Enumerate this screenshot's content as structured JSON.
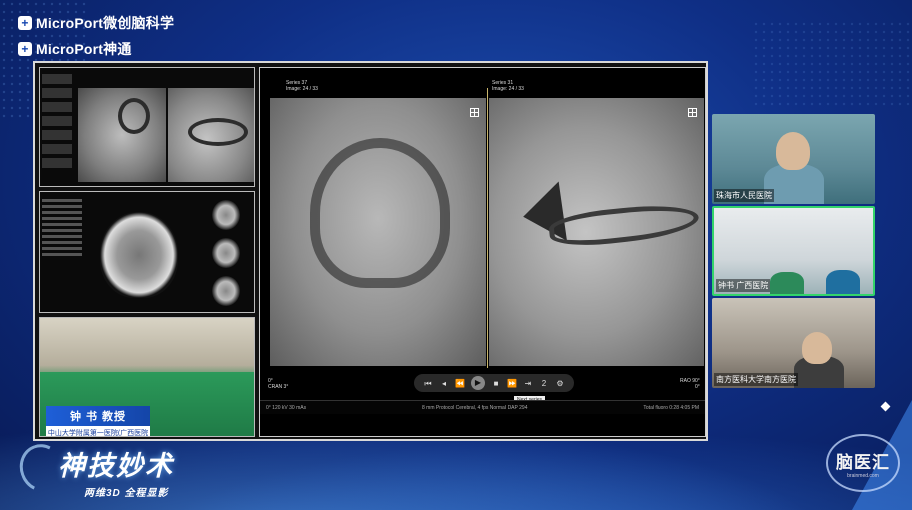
{
  "brand": {
    "line1_mark": "+",
    "line1": "MicroPort微创脑科学",
    "line2_mark": "+",
    "line2": "MicroPort神通"
  },
  "main_viewer": {
    "left_series": "Series 37",
    "left_image": "Image: 24 / 33",
    "right_series": "Series 31",
    "right_image": "Image: 24 / 33",
    "left_angle1": "0°",
    "left_angle2": "CRAN 3°",
    "right_angle1": "RAO 90°",
    "right_angle2": "0°",
    "tooltip": "Next series",
    "toolbar_counter": "2",
    "status_left": "0°   120 kV   30 mAs",
    "status_mid": "8 mm Protocol Cerebral, 4 fps     NormaI     DAP 294",
    "status_right": "Total fluoro 0:28     4:05 PM"
  },
  "speaker_tag": {
    "name": "钟 书 教授",
    "affiliation": "中山大学附属第一医院(广西医院"
  },
  "videos": [
    {
      "label": "珠海市人民医院"
    },
    {
      "label": "钟书 广西医院"
    },
    {
      "label": "南方医科大学南方医院"
    }
  ],
  "show_logo": {
    "title": "神技妙术",
    "subtitle": "两维3D 全程显影"
  },
  "naoyihui": {
    "title": "脑医汇",
    "site": "brainmed.com"
  },
  "colors": {
    "accent": "#1e5fd8",
    "active_video_border": "#33d46a"
  }
}
